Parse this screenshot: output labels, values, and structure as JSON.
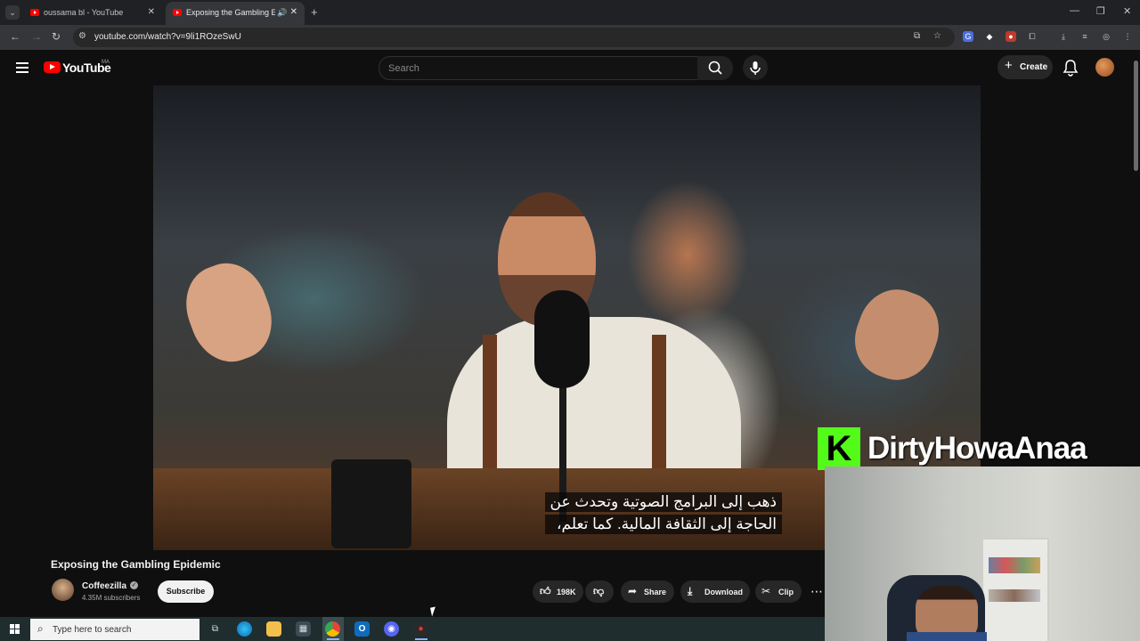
{
  "browser": {
    "tabs": [
      {
        "title": "oussama bl - YouTube",
        "active": false
      },
      {
        "title": "Exposing the Gambling Epid",
        "active": true
      }
    ],
    "url": "youtube.com/watch?v=9li1ROzeSwU"
  },
  "youtube": {
    "logo_text": "YouTube",
    "country": "MA",
    "search_placeholder": "Search",
    "create_label": "Create"
  },
  "video": {
    "subtitles": [
      "ذهب إلى البرامج الصوتية وتحدث عن",
      "الحاجة إلى الثقافة المالية.  كما تعلم،"
    ],
    "title": "Exposing the Gambling Epidemic",
    "channel": "Coffeezilla",
    "verified_mark": "✓",
    "subscribers": "4.35M subscribers",
    "subscribe_label": "Subscribe",
    "likes": "198K",
    "share_label": "Share",
    "download_label": "Download",
    "clip_label": "Clip",
    "more_label": "⋯"
  },
  "overlay": {
    "kick_letter": "K",
    "streamer_name": "DirtyHowaAnaa"
  },
  "taskbar": {
    "search_placeholder": "Type here to search"
  },
  "colors": {
    "youtube_red": "#ff0000",
    "kick_green": "#53fc18",
    "page_bg": "#0f0f0f"
  }
}
